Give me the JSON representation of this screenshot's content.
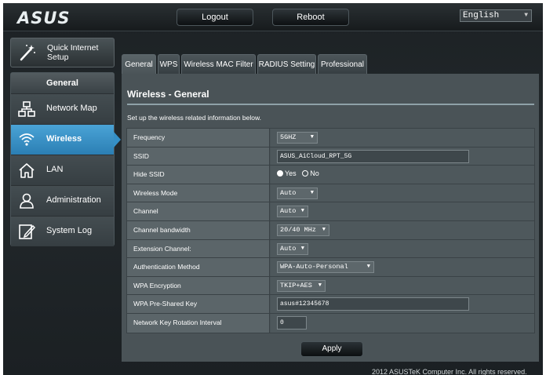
{
  "brand": "ASUS",
  "topbar": {
    "logout_label": "Logout",
    "reboot_label": "Reboot",
    "language_selected": "English"
  },
  "sidebar": {
    "quick_setup_label": "Quick Internet Setup",
    "section_title": "General",
    "items": [
      {
        "label": "Network Map",
        "icon": "network-map-icon",
        "active": false
      },
      {
        "label": "Wireless",
        "icon": "wifi-icon",
        "active": true
      },
      {
        "label": "LAN",
        "icon": "home-icon",
        "active": false
      },
      {
        "label": "Administration",
        "icon": "user-icon",
        "active": false
      },
      {
        "label": "System Log",
        "icon": "log-icon",
        "active": false
      }
    ]
  },
  "tabs": [
    {
      "label": "General",
      "active": true
    },
    {
      "label": "WPS",
      "active": false
    },
    {
      "label": "Wireless MAC Filter",
      "active": false
    },
    {
      "label": "RADIUS Setting",
      "active": false
    },
    {
      "label": "Professional",
      "active": false
    }
  ],
  "panel": {
    "title": "Wireless - General",
    "description": "Set up the wireless related information below."
  },
  "form": {
    "frequency": {
      "label": "Frequency",
      "value": "5GHZ"
    },
    "ssid": {
      "label": "SSID",
      "value": "ASUS_AiCloud_RPT_5G"
    },
    "hide_ssid": {
      "label": "Hide SSID",
      "yes_label": "Yes",
      "no_label": "No",
      "selected": "Yes"
    },
    "wireless_mode": {
      "label": "Wireless Mode",
      "value": "Auto"
    },
    "channel": {
      "label": "Channel",
      "value": "Auto"
    },
    "channel_bandwidth": {
      "label": "Channel bandwidth",
      "value": "20/40 MHz"
    },
    "extension_channel": {
      "label": "Extension Channel:",
      "value": "Auto"
    },
    "auth_method": {
      "label": "Authentication Method",
      "value": "WPA-Auto-Personal"
    },
    "wpa_encryption": {
      "label": "WPA Encryption",
      "value": "TKIP+AES"
    },
    "wpa_psk": {
      "label": "WPA Pre-Shared Key",
      "value": "asus#12345678"
    },
    "key_rotation": {
      "label": "Network Key Rotation Interval",
      "value": "0"
    }
  },
  "apply_label": "Apply",
  "footer": "2012 ASUSTeK Computer Inc. All rights reserved.",
  "colors": {
    "accent": "#3590c7",
    "panel": "#4a5357",
    "background": "#1c2124"
  }
}
